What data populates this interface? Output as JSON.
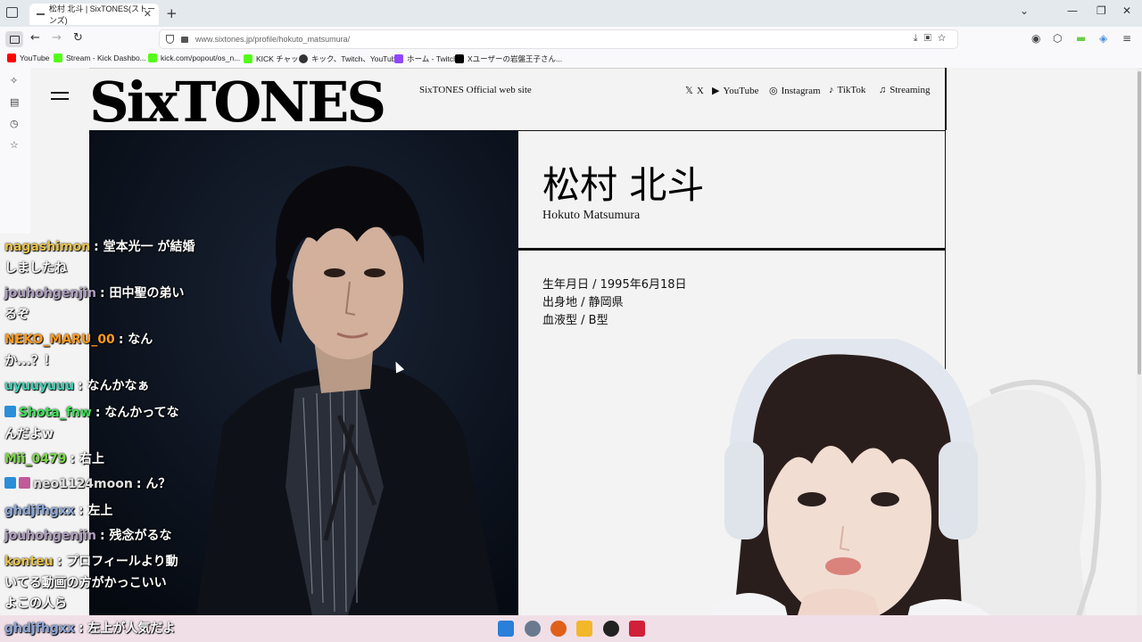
{
  "browser": {
    "tab_title": "松村 北斗 | SixTONES(ストーンズ)",
    "url": "www.sixtones.jp/profile/hokuto_matsumura/",
    "bookmarks": [
      {
        "label": "YouTube",
        "color": "#ff0000"
      },
      {
        "label": "Stream - Kick Dashbo...",
        "color": "#53fc18"
      },
      {
        "label": "kick.com/popout/os_n...",
        "color": "#53fc18"
      },
      {
        "label": "KICK チャット",
        "color": "#53fc18"
      },
      {
        "label": "キック、Twitch、YouTub...",
        "color": "#333333"
      },
      {
        "label": "ホーム - Twitch",
        "color": "#9146ff"
      },
      {
        "label": "Xユーザーの岩盤王子さん...",
        "color": "#000000"
      }
    ]
  },
  "site": {
    "logo": "SixTONES",
    "tagline": "SixTONES Official web site",
    "social": [
      {
        "icon": "x-icon",
        "glyph": "𝕏",
        "label": "X"
      },
      {
        "icon": "youtube-icon",
        "glyph": "▶",
        "label": "YouTube"
      },
      {
        "icon": "instagram-icon",
        "glyph": "◎",
        "label": "Instagram"
      },
      {
        "icon": "tiktok-icon",
        "glyph": "♪",
        "label": "TikTok"
      },
      {
        "icon": "streaming-icon",
        "glyph": "♫",
        "label": "Streaming"
      }
    ]
  },
  "profile": {
    "name_ja": "松村 北斗",
    "name_en": "Hokuto Matsumura",
    "birthday": "生年月日 / 1995年6月18日",
    "birthplace": "出身地 / 静岡県",
    "blood_type": "血液型 / B型"
  },
  "chat": [
    {
      "user": "nagashimon",
      "user_color": "#e8c34a",
      "msg": ": 堂本光一 が結婚",
      "badge": false
    },
    {
      "user": "",
      "user_color": "#ffffff",
      "msg": "しましたね",
      "badge": false
    },
    {
      "user": "jouhohgenjin",
      "user_color": "#b0a0c0",
      "msg": ": 田中聖の弟い",
      "badge": false
    },
    {
      "user": "",
      "user_color": "#ffffff",
      "msg": "るぞ",
      "badge": false
    },
    {
      "user": "NEKO_MARU_00",
      "user_color": "#ff9a1f",
      "msg": ": なん",
      "badge": false
    },
    {
      "user": "",
      "user_color": "#ffffff",
      "msg": "か...？！",
      "badge": false
    },
    {
      "user": "uyuuyuuu",
      "user_color": "#3fd2b5",
      "msg": ": なんかなぁ",
      "badge": false
    },
    {
      "user": "Shota_fnw",
      "user_color": "#3fe05a",
      "msg": ": なんかってな",
      "badge": true
    },
    {
      "user": "",
      "user_color": "#ffffff",
      "msg": "んだよw",
      "badge": false
    },
    {
      "user": "Mii_0479",
      "user_color": "#7cd94a",
      "msg": ": 右上",
      "badge": false
    },
    {
      "user": "neo1124moon",
      "user_color": "#e0e0e0",
      "msg": ": ん？",
      "badge": true
    },
    {
      "user": "ghdjfhgxx",
      "user_color": "#8fa8d8",
      "msg": ": 左上",
      "badge": false
    },
    {
      "user": "jouhohgenjin",
      "user_color": "#b0a0c0",
      "msg": ": 残念がるな",
      "badge": false
    },
    {
      "user": "konteu",
      "user_color": "#e8c34a",
      "msg": ": プロフィールより動",
      "badge": false
    },
    {
      "user": "",
      "user_color": "#ffffff",
      "msg": "いてる動画の方がかっこいい",
      "badge": false
    },
    {
      "user": "",
      "user_color": "#ffffff",
      "msg": "よこの人ら",
      "badge": false
    },
    {
      "user": "ghdjfhgxx",
      "user_color": "#8fa8d8",
      "msg": ": 左上が人気だよ",
      "badge": false
    }
  ]
}
